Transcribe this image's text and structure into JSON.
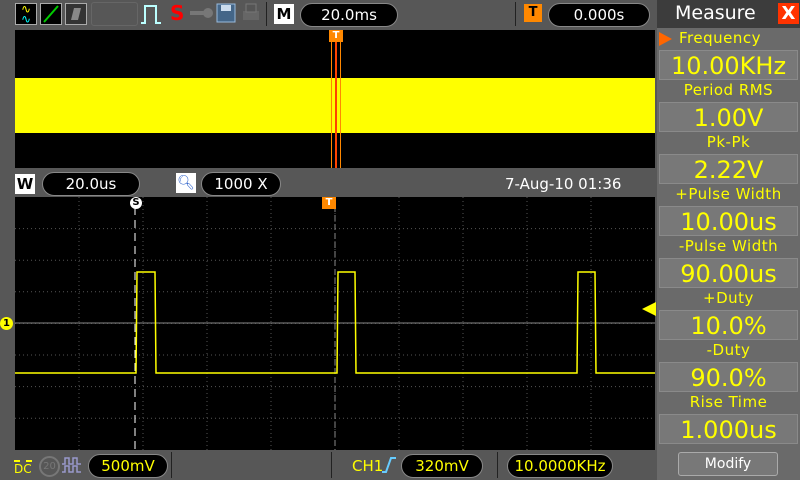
{
  "toolbar": {
    "icons": [
      "waveform-icon",
      "cursor-line-icon",
      "persistence-icon",
      "pulse-icon",
      "single-s-icon",
      "key-icon",
      "save-icon",
      "print-icon"
    ],
    "single_label": "S",
    "m_label": "M",
    "timebase": "20.0ms",
    "trigger_label": "T",
    "trigger_pos": "0.000s"
  },
  "window": {
    "w_label": "W",
    "window_timebase": "20.0us",
    "zoom": "1000 X",
    "datetime": "7-Aug-10 01:36"
  },
  "markers": {
    "s": "S",
    "t": "T",
    "ch": "1"
  },
  "bottom": {
    "coupling": "DC",
    "bw": "20",
    "volts": "500mV",
    "trigger_ch": "CH1",
    "trigger_level": "320mV",
    "frequency": "10.0000KHz"
  },
  "measure": {
    "title": "Measure",
    "close": "X",
    "items": [
      {
        "label": "Frequency",
        "value": "10.00KHz"
      },
      {
        "label": "Period RMS",
        "value": "1.00V"
      },
      {
        "label": "Pk-Pk",
        "value": "2.22V"
      },
      {
        "label": "+Pulse Width",
        "value": "10.00us"
      },
      {
        "label": "-Pulse Width",
        "value": "90.00us"
      },
      {
        "label": "+Duty",
        "value": "10.0%"
      },
      {
        "label": "-Duty",
        "value": "90.0%"
      },
      {
        "label": "Rise Time",
        "value": "1.000us"
      }
    ],
    "modify": "Modify"
  },
  "colors": {
    "trace": "#ffff00",
    "trigger": "#ff7f00"
  }
}
